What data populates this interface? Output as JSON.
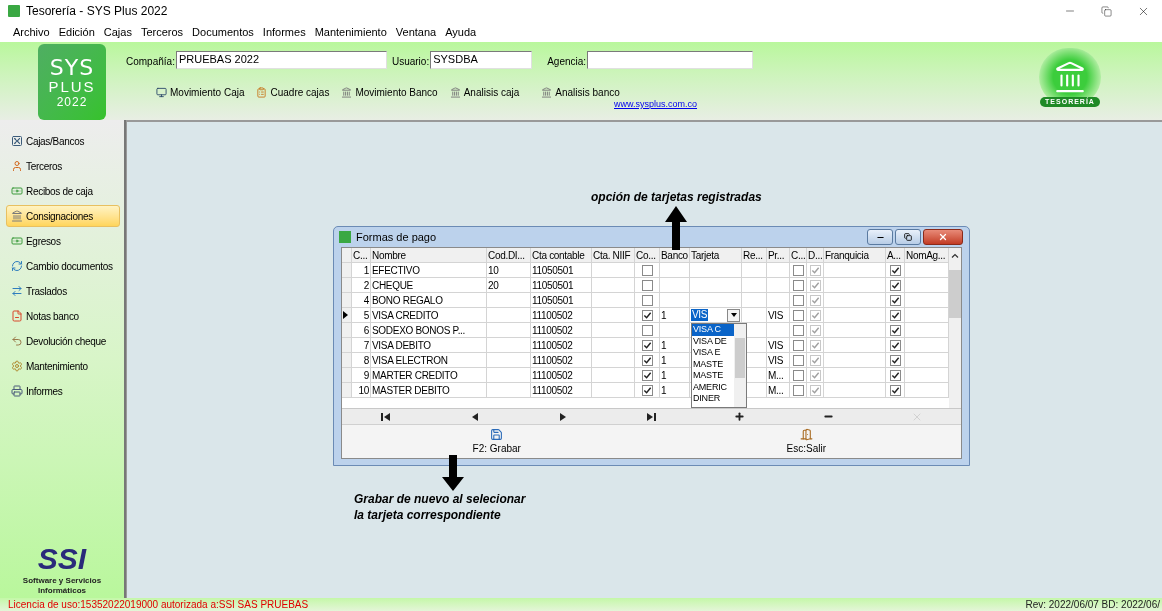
{
  "window": {
    "title": "Tesorería - SYS Plus 2022"
  },
  "menu": [
    "Archivo",
    "Edición",
    "Cajas",
    "Terceros",
    "Documentos",
    "Informes",
    "Mantenimiento",
    "Ventana",
    "Ayuda"
  ],
  "logo": {
    "line_1": "SYS",
    "line_2": "PLUS",
    "line_3": "2022"
  },
  "header_fields": [
    {
      "label": "Compañía:",
      "value": "PRUEBAS 2022"
    },
    {
      "label": "Usuario:",
      "value": "SYSDBA"
    },
    {
      "label": "Agencia:"
    }
  ],
  "toolbar": [
    "Movimiento Caja",
    "Cuadre cajas",
    "Movimiento Banco",
    "Analisis caja",
    "Analisis banco"
  ],
  "link": "www.sysplus.com.co",
  "module_badge": "TESORERÍA",
  "sidebar": {
    "items": [
      {
        "label": "Cajas/Bancos",
        "selected": false
      },
      {
        "label": "Terceros",
        "selected": false
      },
      {
        "label": "Recibos de caja",
        "selected": false
      },
      {
        "label": "Consignaciones",
        "selected": true
      },
      {
        "label": "Egresos",
        "selected": false
      },
      {
        "label": "Cambio documentos",
        "selected": false
      },
      {
        "label": "Traslados",
        "selected": false
      },
      {
        "label": "Notas banco",
        "selected": false
      },
      {
        "label": "Devolución cheque",
        "selected": false
      },
      {
        "label": "Mantenimiento",
        "selected": false
      },
      {
        "label": "Informes",
        "selected": false
      }
    ]
  },
  "sidebar_logo": {
    "mark": "SSI",
    "caption": "Software y Servicios Informáticos"
  },
  "dialog": {
    "title": "Formas de pago",
    "columns": [
      "C...",
      "Nombre",
      "Cod.DI...",
      "Cta contable",
      "Cta. NIIF",
      "Co...",
      "Banco",
      "Tarjeta",
      "Re...",
      "Pr...",
      "C...",
      "D...",
      "Franquicia",
      "A...",
      "NomAg..."
    ],
    "rows": [
      {
        "number": "1",
        "name": "EFECTIVO",
        "cod_di": "10",
        "cta_contable": "11050501",
        "co": false,
        "c": false,
        "d": true,
        "a": true,
        "selected": false
      },
      {
        "number": "2",
        "name": "CHEQUE",
        "cod_di": "20",
        "cta_contable": "11050501",
        "co": false,
        "c": false,
        "d": true,
        "a": true,
        "selected": false
      },
      {
        "number": "4",
        "name": "BONO REGALO",
        "cta_contable": "11050501",
        "co": false,
        "c": false,
        "d": true,
        "a": true,
        "selected": false
      },
      {
        "number": "5",
        "name": "VISA CREDITO",
        "cta_contable": "11100502",
        "co": true,
        "banco": "1",
        "tarjeta": "VIS",
        "pr": "VIS",
        "c": false,
        "d": true,
        "a": true,
        "selected": true
      },
      {
        "number": "6",
        "name": "SODEXO BONOS P...",
        "cta_contable": "11100502",
        "co": false,
        "c": false,
        "d": true,
        "a": true,
        "selected": false
      },
      {
        "number": "7",
        "name": "VISA DEBITO",
        "cta_contable": "11100502",
        "co": true,
        "banco": "1",
        "pr": "VIS",
        "c": false,
        "d": true,
        "a": true,
        "selected": false
      },
      {
        "number": "8",
        "name": "VISA ELECTRON",
        "cta_contable": "11100502",
        "co": true,
        "banco": "1",
        "pr": "VIS",
        "c": false,
        "d": true,
        "a": true,
        "selected": false
      },
      {
        "number": "9",
        "name": "MARTER CREDITO",
        "cta_contable": "11100502",
        "co": true,
        "banco": "1",
        "pr": "M...",
        "c": false,
        "d": true,
        "a": true,
        "selected": false
      },
      {
        "number": "10",
        "name": "MASTER DEBITO",
        "cta_contable": "11100502",
        "co": true,
        "banco": "1",
        "pr": "M...",
        "c": false,
        "d": true,
        "a": true,
        "selected": false
      }
    ],
    "dropdown": [
      {
        "label": "VISA C",
        "selected": true
      },
      {
        "label": "VISA DE",
        "selected": false
      },
      {
        "label": "VISA E",
        "selected": false
      },
      {
        "label": "MASTE",
        "selected": false
      },
      {
        "label": "MASTE",
        "selected": false
      },
      {
        "label": "AMERIC",
        "selected": false
      },
      {
        "label": "DINER",
        "selected": false
      }
    ],
    "navigator": [
      {
        "kind": "first",
        "disabled": false
      },
      {
        "kind": "prior",
        "disabled": false
      },
      {
        "kind": "next",
        "disabled": false
      },
      {
        "kind": "last",
        "disabled": false
      },
      {
        "kind": "insert",
        "disabled": false
      },
      {
        "kind": "delete",
        "disabled": false
      },
      {
        "kind": "cancel",
        "disabled": true
      }
    ],
    "buttons": [
      {
        "kind": "save",
        "label": "F2: Grabar"
      },
      {
        "kind": "exit",
        "label": "Esc:Salir"
      }
    ]
  },
  "annotations": [
    {
      "kind": "up",
      "lines": [
        "opción de tarjetas registradas"
      ]
    },
    {
      "kind": "down",
      "lines": [
        "Grabar de nuevo al selecionar",
        "la tarjeta correspondiente"
      ]
    }
  ],
  "status_bar": {
    "license": "Licencia de uso:15352022019000 autorizada a:SSI SAS PRUEBAS",
    "revision": "Rev: 2022/06/07 BD: 2022/06/"
  }
}
